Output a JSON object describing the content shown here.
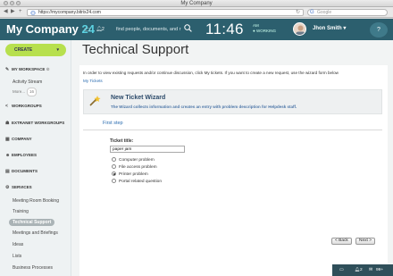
{
  "window": {
    "title": "My Company"
  },
  "browser": {
    "url": "https://mycompany.bitrix24.com",
    "search_placeholder": "Google",
    "back": "◀",
    "forward": "▶",
    "add_tab": "+"
  },
  "header": {
    "brand": "My Company",
    "brand_num": "24",
    "notif_count": "2",
    "search_text": "find people, documents, and r",
    "clock": "11:46",
    "ampm": "AM",
    "work_status": "WORKING",
    "user": "Jhon Smith",
    "help": "?"
  },
  "sidebar": {
    "create": "CREATE",
    "groups": {
      "my_workspace": "MY WORKSPACE",
      "workgroups": "WORKGROUPS",
      "extranet": "EXTRANET WORKGROUPS",
      "company": "COMPANY",
      "employees": "EMPLOYEES",
      "documents": "DOCUMENTS",
      "services": "SERVICES"
    },
    "activity_stream": "Activity Stream",
    "more": "More...",
    "more_count": "16",
    "services_items": [
      "Meeting Room Booking",
      "Training",
      "Technical Support",
      "Meetings and Briefings",
      "Ideas",
      "Lists",
      "Business Processes"
    ]
  },
  "main": {
    "title": "Technical Support",
    "intro": "In order to view existing requests and/or continue discussion, click My tickets. If you want to create a new request, use the wizard form below",
    "my_tickets": "My Tickets",
    "wizard_title": "New Ticket Wizard",
    "wizard_desc": "The Wizard collects information and creates an entry with problem description for Helpdesk staff.",
    "first_step": "First step",
    "ticket_title_label": "Ticket title:",
    "ticket_title_value": "paper jam",
    "options": [
      "Computer problem",
      "File access problem",
      "Printer problem",
      "Portal related question"
    ],
    "selected_option": 2,
    "back_btn": "< Back",
    "next_btn": "Next >"
  },
  "chatbar": {
    "count": "2",
    "status": "99+"
  }
}
